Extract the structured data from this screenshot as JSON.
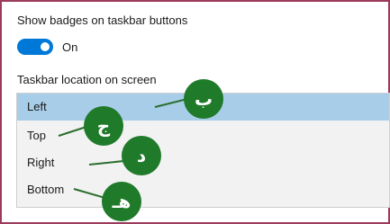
{
  "badges_setting": {
    "label": "Show badges on taskbar buttons",
    "toggle_state_label": "On",
    "toggle_on": true
  },
  "taskbar_location": {
    "label": "Taskbar location on screen",
    "options": [
      "Left",
      "Top",
      "Right",
      "Bottom"
    ],
    "selected_index": 0
  },
  "annotations": {
    "callouts": [
      "ب",
      "ج",
      "د",
      "هـ"
    ]
  },
  "colors": {
    "accent": "#0078d7",
    "selected_row": "#a8cde8",
    "callout": "#1f7a2a",
    "frame_border": "#9b3a5a"
  }
}
